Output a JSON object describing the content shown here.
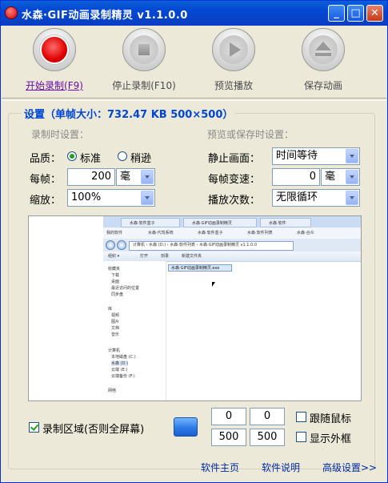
{
  "window": {
    "title": "水森·GIF动画录制精灵 v1.1.0.0",
    "controls": {
      "minimize": "_",
      "maximize": "□",
      "close": "✕"
    }
  },
  "toolbar": {
    "items": [
      {
        "label": "开始录制(F9)",
        "icon": "record-icon",
        "active": true
      },
      {
        "label": "停止录制(F10)",
        "icon": "stop-icon",
        "active": false
      },
      {
        "label": "预览播放",
        "icon": "play-icon",
        "active": false
      },
      {
        "label": "保存动画",
        "icon": "eject-save-icon",
        "active": false
      }
    ]
  },
  "settings": {
    "title": "设置（单帧大小：732.47 KB 500×500）",
    "record_section": "录制时设置：",
    "preview_section": "预览或保存时设置：",
    "quality_label": "品质：",
    "quality_options": [
      "标准",
      "稍逊"
    ],
    "quality_selected": "标准",
    "per_frame_label": "每帧：",
    "per_frame_value": "200",
    "per_frame_unit": "毫",
    "scale_label": "缩放：",
    "scale_value": "100%",
    "still_label": "静止画面：",
    "still_value": "时间等待",
    "frame_speed_label": "每帧变速：",
    "frame_speed_value": "0",
    "frame_speed_unit": "毫",
    "play_count_label": "播放次数：",
    "play_count_value": "无限循环"
  },
  "preview": {
    "tabs": [
      "水森·软件盒子",
      "水森·GIF动画录制精灵",
      "水森·软件"
    ],
    "favorites": [
      "我的软件",
      "水森·代驾系统",
      "水森·软件盒子",
      "水森·软件列表",
      "水森·合众"
    ],
    "path": "计算机 › 水森 (D:) › 水森·软件列表 › 水森·GIF动画录制精灵 v1.1.0.0",
    "commands": [
      "组织 ▾",
      "打开",
      "刻录",
      "新建文件夹"
    ],
    "sidebar": [
      "收藏夹",
      "下载",
      "桌面",
      "最近访问的位置",
      "同步盘",
      "库",
      "视频",
      "图片",
      "文档",
      "音乐",
      "计算机",
      "本地磁盘 (C:)",
      "水森 (D:)",
      "云端 (E:)",
      "云端备份 (F:)",
      "网络"
    ],
    "file": "水森·GIF动画录制精灵.exe"
  },
  "region": {
    "checkbox_label": "录制区域(否则全屏幕)",
    "checked": true,
    "x": "0",
    "y": "0",
    "width": "500",
    "height": "500",
    "follow_mouse_label": "跟随鼠标",
    "follow_mouse_checked": false,
    "show_frame_label": "显示外框",
    "show_frame_checked": false
  },
  "links": {
    "home": "软件主页",
    "help": "软件说明",
    "advanced": "高级设置>>"
  }
}
